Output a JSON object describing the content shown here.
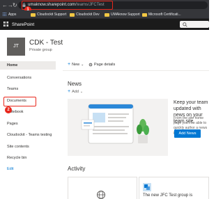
{
  "browser": {
    "url_host": "umaknow.sharepoint.com",
    "url_path": "/teams/JFCTest",
    "bookmarks": [
      "Apps",
      "Cloudockit Support",
      "Cloudockit Dev",
      "UMAknow Support",
      "Microsoft Certificati..."
    ]
  },
  "markers": {
    "first": "1",
    "second": "2"
  },
  "suite": {
    "brand": "SharePoint"
  },
  "site": {
    "logo_initials": "JT",
    "title": "CDK - Test",
    "subtitle": "Private group"
  },
  "nav": {
    "items": [
      "Home",
      "Conversations",
      "Teams",
      "Documents",
      "Notebook",
      "Pages",
      "Cloudockit - Teams testing",
      "Site contents",
      "Recycle bin",
      "Edit"
    ]
  },
  "commands": {
    "new": "New",
    "page_details": "Page details"
  },
  "news": {
    "title": "News",
    "add": "Add",
    "promo_title": "Keep your team updated with news on your team site",
    "promo_body": "From the site home page you'll be able to quickly author a news post",
    "add_news_button": "Add News"
  },
  "activity": {
    "title": "Activity",
    "card2_text": "The new JFC Test group is"
  },
  "colors": {
    "accent": "#0078d4",
    "annotation_red": "#e8271c",
    "suite_bar": "#1b1b1b"
  }
}
